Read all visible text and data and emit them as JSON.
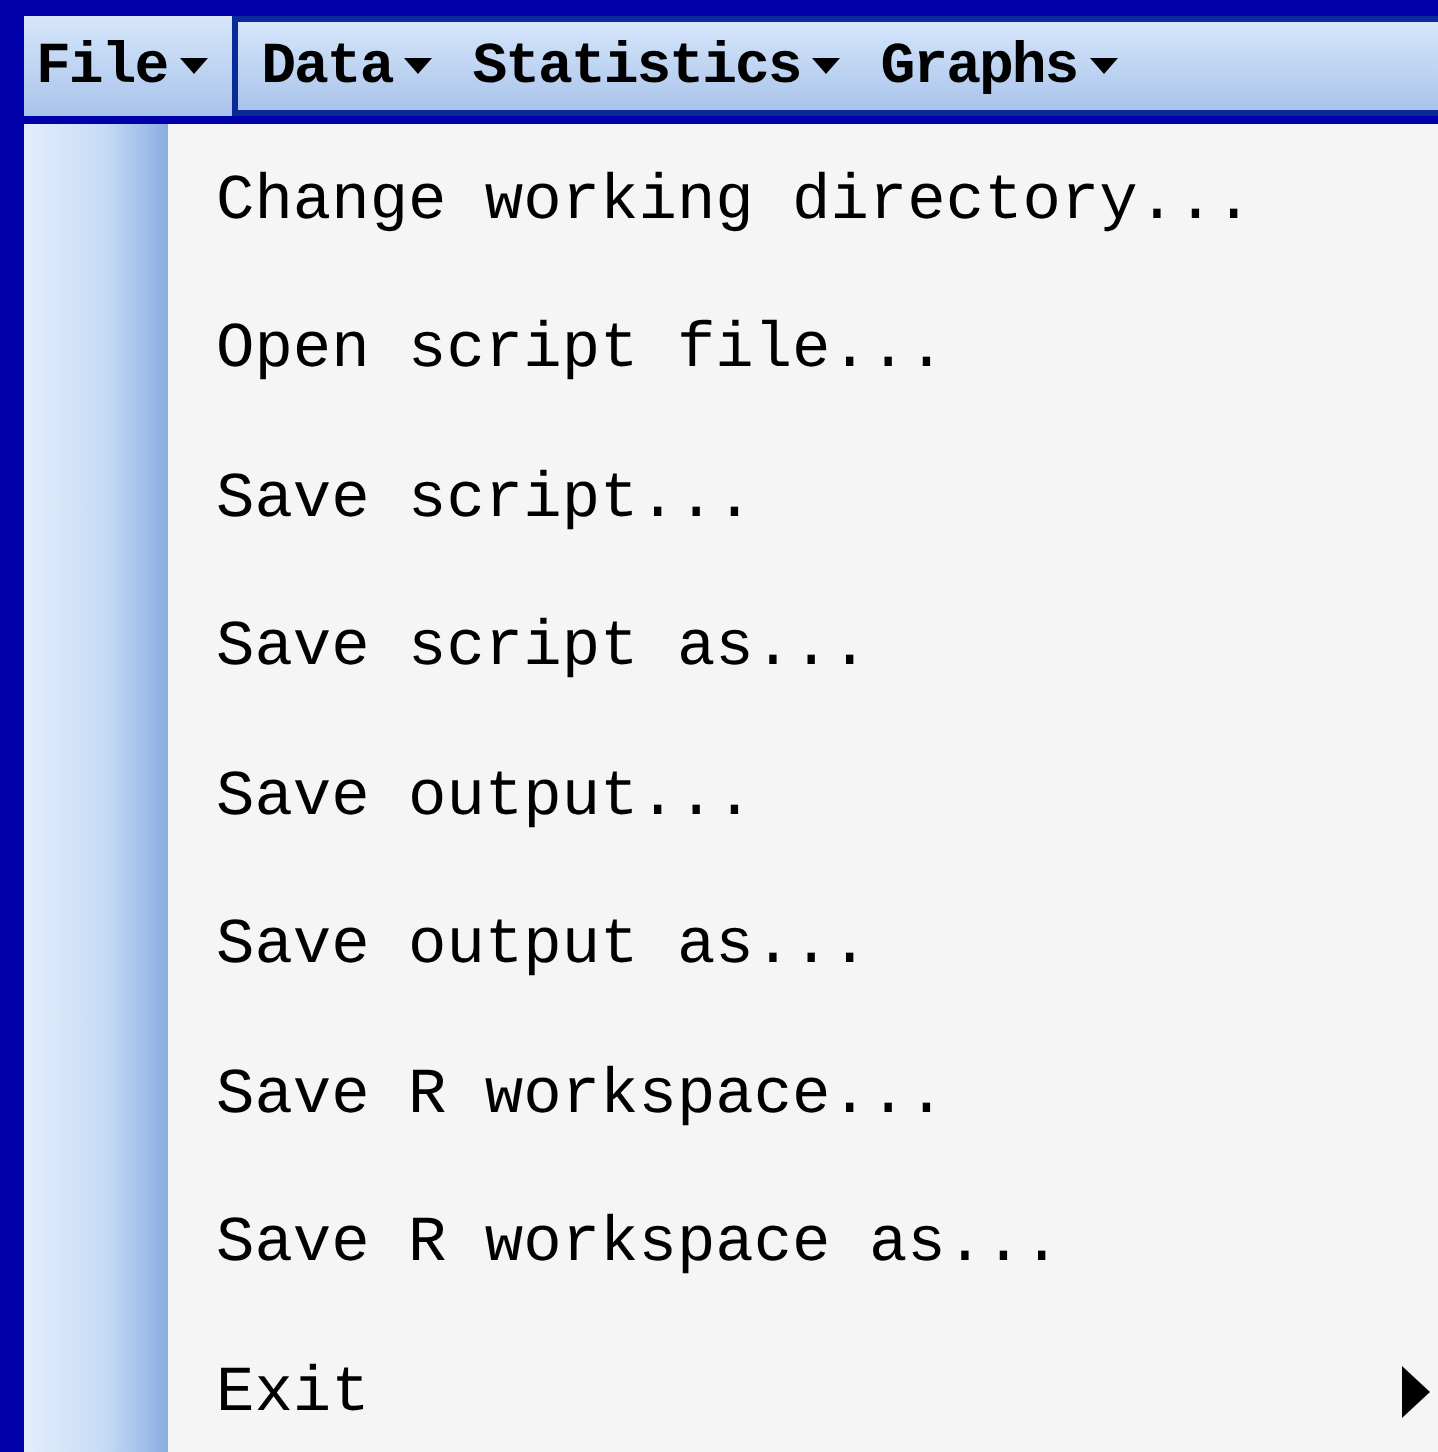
{
  "menu_bar": [
    {
      "label": "File",
      "selected": true
    },
    {
      "label": "Data",
      "selected": false
    },
    {
      "label": "Statistics",
      "selected": false
    },
    {
      "label": "Graphs",
      "selected": false
    }
  ],
  "menu": {
    "items": [
      {
        "label": "Change working directory...",
        "submenu": false
      },
      {
        "label": "Open script file...",
        "submenu": false
      },
      {
        "label": "Save script...",
        "submenu": false
      },
      {
        "label": "Save script as...",
        "submenu": false
      },
      {
        "label": "Save output...",
        "submenu": false
      },
      {
        "label": "Save output as...",
        "submenu": false
      },
      {
        "label": "Save R workspace...",
        "submenu": false
      },
      {
        "label": "Save R workspace as...",
        "submenu": false
      },
      {
        "label": "Exit",
        "submenu": true
      }
    ]
  }
}
